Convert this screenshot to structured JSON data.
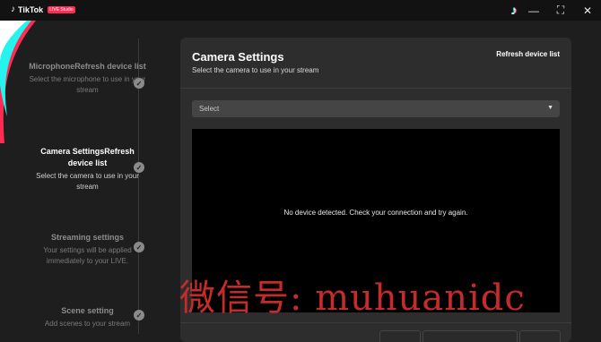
{
  "app": {
    "logo_text": "TikTok",
    "logo_badge": "LIVE Studio",
    "logo_glyph": "♪",
    "tiktok_glyph": "♪"
  },
  "window_controls": {
    "minimize": "—",
    "maximize": "⛶",
    "close": "✕"
  },
  "steps": [
    {
      "title": "MicrophoneRefresh device list",
      "desc": "Select the microphone to use in your stream",
      "state": "done"
    },
    {
      "title": "Camera SettingsRefresh device list",
      "desc": "Select the camera to use in your stream",
      "state": "active"
    },
    {
      "title": "Streaming settings",
      "desc": "Your settings will be applied immediately to your LIVE.",
      "state": "done"
    },
    {
      "title": "Scene setting",
      "desc": "Add scenes to your stream",
      "state": "done"
    }
  ],
  "check_glyph": "✓",
  "panel": {
    "title": "Camera Settings",
    "subtitle": "Select the camera to use in your stream",
    "refresh_label": "Refresh device list",
    "select_value": "Select",
    "caret": "▼",
    "preview_message": "No device detected. Check your connection and try again."
  },
  "watermark": "微信号: muhuanidc",
  "colors": {
    "accent_pink": "#fe2c55",
    "accent_cyan": "#25f4ee",
    "watermark": "#c52b2b"
  }
}
